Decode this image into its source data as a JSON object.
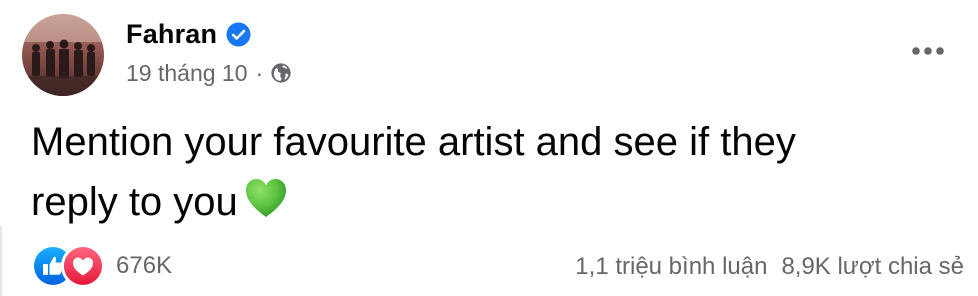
{
  "post": {
    "author": {
      "name": "Fahran",
      "verified": true,
      "avatar_icon": "band-photo-avatar"
    },
    "date": "19 tháng 10",
    "meta_separator": "·",
    "audience_icon": "globe-icon",
    "more_icon": "more-options-icon",
    "text_line1": "Mention your favourite artist and see if they",
    "text_line2": "reply to you",
    "text_emoji": "green-heart-icon"
  },
  "stats": {
    "reactions": [
      "like-reaction-icon",
      "love-reaction-icon"
    ],
    "reaction_count": "676K",
    "comments": "1,1 triệu bình luận",
    "shares": "8,9K lượt chia sẻ"
  },
  "colors": {
    "text_primary": "#050505",
    "text_secondary": "#65676b",
    "verified_blue": "#1877f2",
    "like_blue": "#1877f2",
    "love_red": "#f33e58",
    "heart_green": "#5ac23f"
  }
}
